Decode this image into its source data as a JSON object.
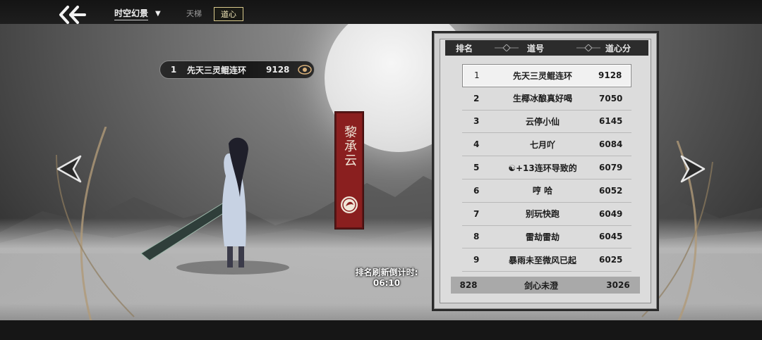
{
  "topbar": {
    "mode_label": "时空幻景",
    "tabs": [
      {
        "label": "天梯",
        "active": false
      },
      {
        "label": "道心",
        "active": true
      }
    ]
  },
  "player_summary": {
    "rank": "1",
    "name": "先天三灵鲲连环",
    "score": "9128"
  },
  "character_banner": {
    "name": "黎承云"
  },
  "timer": {
    "label": "排名刷新倒计时:",
    "value": "06:10"
  },
  "leaderboard": {
    "headers": {
      "rank": "排名",
      "name": "道号",
      "score": "道心分"
    },
    "rows": [
      {
        "rank": "1",
        "name": "先天三灵鲲连环",
        "score": "9128"
      },
      {
        "rank": "2",
        "name": "生椰冰酿真好喝",
        "score": "7050"
      },
      {
        "rank": "3",
        "name": "云停小仙",
        "score": "6145"
      },
      {
        "rank": "4",
        "name": "七月吖",
        "score": "6084"
      },
      {
        "rank": "5",
        "name": "☯+13连环导致的",
        "score": "6079"
      },
      {
        "rank": "6",
        "name": "哼  哈",
        "score": "6052"
      },
      {
        "rank": "7",
        "name": "别玩快跑",
        "score": "6049"
      },
      {
        "rank": "8",
        "name": "雷劫雷劫",
        "score": "6045"
      },
      {
        "rank": "9",
        "name": "暴雨未至微风已起",
        "score": "6025"
      }
    ],
    "self": {
      "rank": "828",
      "name": "剑心未澄",
      "score": "3026"
    }
  },
  "icons": {
    "back": "double-chevron-back-icon",
    "caret": "chevron-down-icon",
    "eye": "eye-icon",
    "emblem": "sect-emblem-icon",
    "prev": "left-arrow-icon",
    "next": "right-arrow-icon"
  },
  "colors": {
    "banner_red": "#8a1f1f",
    "active_tab_border": "#d8c98c",
    "board_bg": "#dcdcdc",
    "header_bg": "#2c2c2c"
  }
}
